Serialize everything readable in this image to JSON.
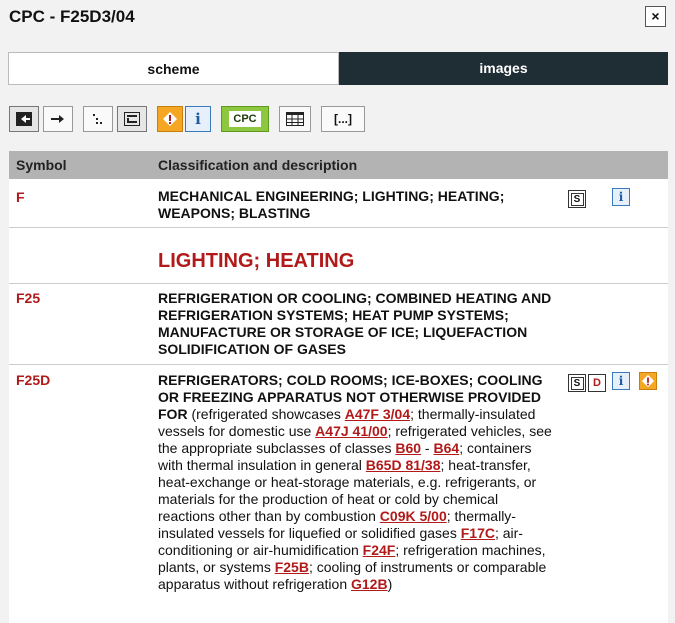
{
  "window": {
    "title": "CPC - F25D3/04",
    "close_label": "×"
  },
  "tabs": [
    {
      "label": "scheme",
      "active": true
    },
    {
      "label": "images",
      "active": false
    }
  ],
  "toolbar": {
    "cpc_label": "CPC",
    "bracket_label": "[...]"
  },
  "table_header": {
    "symbol": "Symbol",
    "description": "Classification and description"
  },
  "rows": [
    {
      "symbol": "F",
      "title": "MECHANICAL ENGINEERING; LIGHTING; HEATING; WEAPONS; BLASTING"
    },
    {
      "heading": "LIGHTING; HEATING"
    },
    {
      "symbol": "F25",
      "title": "REFRIGERATION OR COOLING; COMBINED HEATING AND REFRIGERATION SYSTEMS; HEAT PUMP SYSTEMS; MANUFACTURE OR STORAGE OF ICE; LIQUEFACTION SOLIDIFICATION OF GASES"
    },
    {
      "symbol": "F25D",
      "title": "REFRIGERATORS; COLD ROOMS; ICE-BOXES; COOLING OR FREEZING APPARATUS NOT OTHERWISE PROVIDED FOR",
      "t1": " (refrigerated showcases ",
      "l1": "A47F 3/04",
      "t2": "; thermally-insulated vessels for domestic use ",
      "l2": "A47J 41/00",
      "t3": "; refrigerated vehicles, see the appropriate subclasses of classes ",
      "l3": "B60",
      "t4": " - ",
      "l4": "B64",
      "t5": "; containers with thermal insulation in general ",
      "l5": "B65D 81/38",
      "t6": "; heat-transfer, heat-exchange or heat-storage materials, e.g. refrigerants, or materials for the production of heat or cold by chemical reactions other than by combustion ",
      "l6": "C09K 5/00",
      "t7": "; thermally-insulated vessels for liquefied or solidified gases ",
      "l7": "F17C",
      "t8": "; air-conditioning or air-humidification ",
      "l8": "F24F",
      "t9": "; refrigeration machines, plants, or systems ",
      "l9": "F25B",
      "t10": "; cooling of instruments or comparable apparatus without refrigeration ",
      "l10": "G12B",
      "t11": ")"
    }
  ],
  "icon_labels": {
    "s": "S",
    "i": "i",
    "d": "D",
    "warn": "!"
  }
}
